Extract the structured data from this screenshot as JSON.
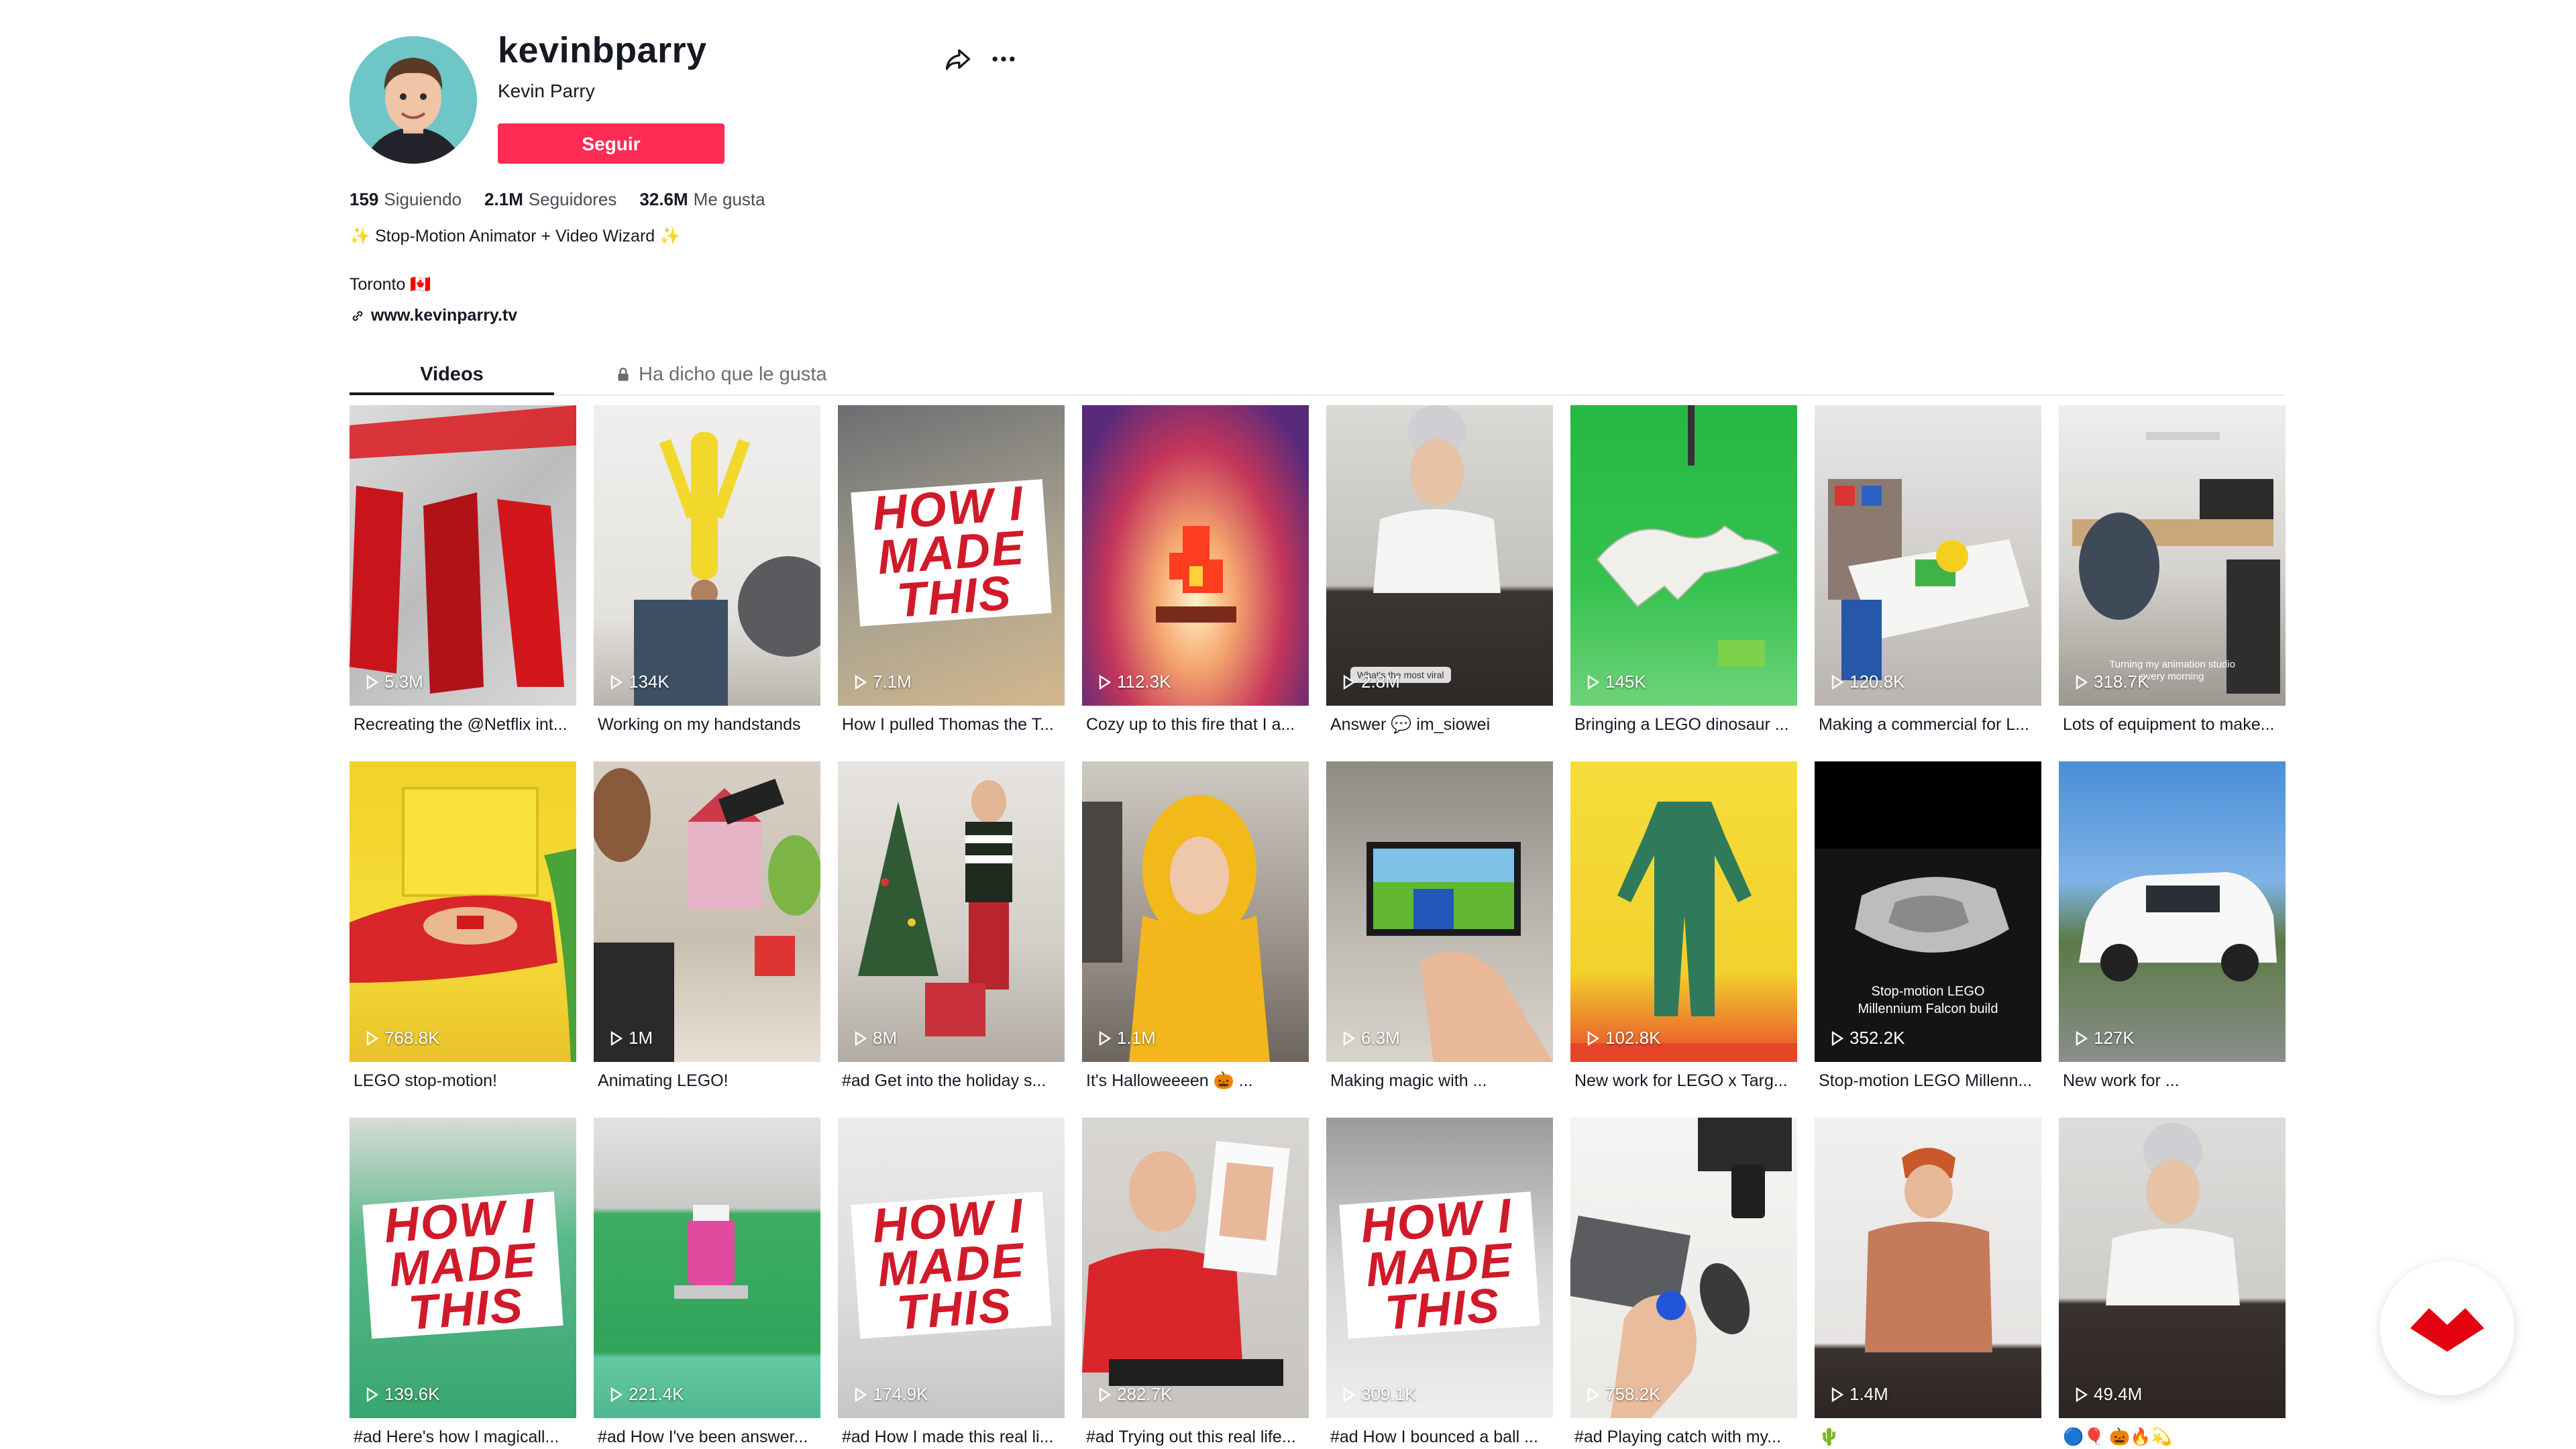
{
  "profile": {
    "username": "kevinbparry",
    "nickname": "Kevin Parry",
    "follow_label": "Seguir",
    "stats": [
      {
        "value": "159",
        "label": "Siguiendo"
      },
      {
        "value": "2.1M",
        "label": "Seguidores"
      },
      {
        "value": "32.6M",
        "label": "Me gusta"
      }
    ],
    "bio": "✨ Stop-Motion Animator + Video Wizard ✨",
    "location": "Toronto 🇨🇦",
    "website": "www.kevinparry.tv"
  },
  "tabs": {
    "videos": "Videos",
    "liked": "Ha dicho que le gusta"
  },
  "videos": [
    {
      "views": "5.3M",
      "caption": "Recreating the @Netflix int..."
    },
    {
      "views": "134K",
      "caption": "Working on my handstands"
    },
    {
      "views": "7.1M",
      "caption": "How I pulled Thomas the T..."
    },
    {
      "views": "112.3K",
      "caption": "Cozy up to this fire that I a..."
    },
    {
      "views": "2.8M",
      "caption": "Answer 💬 im_siowei"
    },
    {
      "views": "145K",
      "caption": "Bringing a LEGO dinosaur ..."
    },
    {
      "views": "120.8K",
      "caption": "Making a commercial for L..."
    },
    {
      "views": "318.7K",
      "caption": "Lots of equipment to make..."
    },
    {
      "views": "768.8K",
      "caption": "LEGO stop-motion!"
    },
    {
      "views": "1M",
      "caption": "Animating LEGO!"
    },
    {
      "views": "8M",
      "caption": "#ad Get into the holiday s..."
    },
    {
      "views": "1.1M",
      "caption": "It's Halloweeeen 🎃 ..."
    },
    {
      "views": "6.3M",
      "caption": "Making magic with ..."
    },
    {
      "views": "102.8K",
      "caption": "New work for LEGO x Targ..."
    },
    {
      "views": "352.2K",
      "caption": "Stop-motion LEGO Millenn..."
    },
    {
      "views": "127K",
      "caption": "New work for ..."
    },
    {
      "views": "139.6K",
      "caption": "#ad Here's how I magicall..."
    },
    {
      "views": "221.4K",
      "caption": "#ad How I've been answer..."
    },
    {
      "views": "174.9K",
      "caption": "#ad How I made this real li..."
    },
    {
      "views": "282.7K",
      "caption": "#ad Trying out this real life..."
    },
    {
      "views": "309.1K",
      "caption": "#ad How I bounced a ball ..."
    },
    {
      "views": "758.2K",
      "caption": "#ad Playing catch with my..."
    },
    {
      "views": "1.4M",
      "caption": "🌵"
    },
    {
      "views": "49.4M",
      "caption": "🔵🎈 🎃🔥💫"
    }
  ],
  "overlays": {
    "how_i_made_this": [
      "HOW I",
      "MADE",
      "THIS"
    ],
    "v5_chip": "What's the most viral",
    "v8_text_1": "Turning my animation studio",
    "v8_text_2": "every morning",
    "v15_text_1": "Stop-motion LEGO",
    "v15_text_2": "Millennium Falcon build"
  },
  "colors": {
    "accent": "#fe2c55",
    "text": "#161823",
    "logo": "#e3000f"
  }
}
